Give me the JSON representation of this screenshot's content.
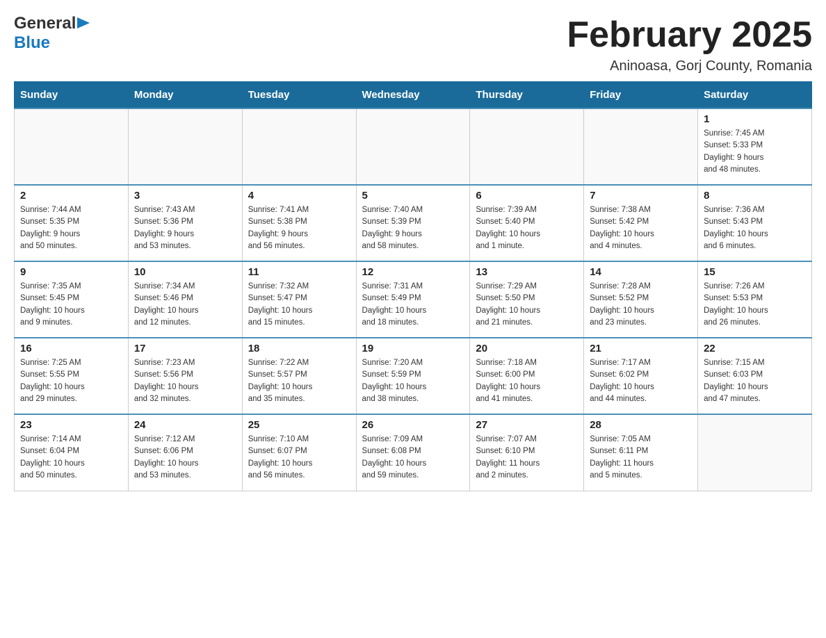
{
  "logo": {
    "general": "General",
    "blue": "Blue"
  },
  "title": "February 2025",
  "subtitle": "Aninoasa, Gorj County, Romania",
  "weekdays": [
    "Sunday",
    "Monday",
    "Tuesday",
    "Wednesday",
    "Thursday",
    "Friday",
    "Saturday"
  ],
  "weeks": [
    [
      {
        "day": "",
        "info": ""
      },
      {
        "day": "",
        "info": ""
      },
      {
        "day": "",
        "info": ""
      },
      {
        "day": "",
        "info": ""
      },
      {
        "day": "",
        "info": ""
      },
      {
        "day": "",
        "info": ""
      },
      {
        "day": "1",
        "info": "Sunrise: 7:45 AM\nSunset: 5:33 PM\nDaylight: 9 hours\nand 48 minutes."
      }
    ],
    [
      {
        "day": "2",
        "info": "Sunrise: 7:44 AM\nSunset: 5:35 PM\nDaylight: 9 hours\nand 50 minutes."
      },
      {
        "day": "3",
        "info": "Sunrise: 7:43 AM\nSunset: 5:36 PM\nDaylight: 9 hours\nand 53 minutes."
      },
      {
        "day": "4",
        "info": "Sunrise: 7:41 AM\nSunset: 5:38 PM\nDaylight: 9 hours\nand 56 minutes."
      },
      {
        "day": "5",
        "info": "Sunrise: 7:40 AM\nSunset: 5:39 PM\nDaylight: 9 hours\nand 58 minutes."
      },
      {
        "day": "6",
        "info": "Sunrise: 7:39 AM\nSunset: 5:40 PM\nDaylight: 10 hours\nand 1 minute."
      },
      {
        "day": "7",
        "info": "Sunrise: 7:38 AM\nSunset: 5:42 PM\nDaylight: 10 hours\nand 4 minutes."
      },
      {
        "day": "8",
        "info": "Sunrise: 7:36 AM\nSunset: 5:43 PM\nDaylight: 10 hours\nand 6 minutes."
      }
    ],
    [
      {
        "day": "9",
        "info": "Sunrise: 7:35 AM\nSunset: 5:45 PM\nDaylight: 10 hours\nand 9 minutes."
      },
      {
        "day": "10",
        "info": "Sunrise: 7:34 AM\nSunset: 5:46 PM\nDaylight: 10 hours\nand 12 minutes."
      },
      {
        "day": "11",
        "info": "Sunrise: 7:32 AM\nSunset: 5:47 PM\nDaylight: 10 hours\nand 15 minutes."
      },
      {
        "day": "12",
        "info": "Sunrise: 7:31 AM\nSunset: 5:49 PM\nDaylight: 10 hours\nand 18 minutes."
      },
      {
        "day": "13",
        "info": "Sunrise: 7:29 AM\nSunset: 5:50 PM\nDaylight: 10 hours\nand 21 minutes."
      },
      {
        "day": "14",
        "info": "Sunrise: 7:28 AM\nSunset: 5:52 PM\nDaylight: 10 hours\nand 23 minutes."
      },
      {
        "day": "15",
        "info": "Sunrise: 7:26 AM\nSunset: 5:53 PM\nDaylight: 10 hours\nand 26 minutes."
      }
    ],
    [
      {
        "day": "16",
        "info": "Sunrise: 7:25 AM\nSunset: 5:55 PM\nDaylight: 10 hours\nand 29 minutes."
      },
      {
        "day": "17",
        "info": "Sunrise: 7:23 AM\nSunset: 5:56 PM\nDaylight: 10 hours\nand 32 minutes."
      },
      {
        "day": "18",
        "info": "Sunrise: 7:22 AM\nSunset: 5:57 PM\nDaylight: 10 hours\nand 35 minutes."
      },
      {
        "day": "19",
        "info": "Sunrise: 7:20 AM\nSunset: 5:59 PM\nDaylight: 10 hours\nand 38 minutes."
      },
      {
        "day": "20",
        "info": "Sunrise: 7:18 AM\nSunset: 6:00 PM\nDaylight: 10 hours\nand 41 minutes."
      },
      {
        "day": "21",
        "info": "Sunrise: 7:17 AM\nSunset: 6:02 PM\nDaylight: 10 hours\nand 44 minutes."
      },
      {
        "day": "22",
        "info": "Sunrise: 7:15 AM\nSunset: 6:03 PM\nDaylight: 10 hours\nand 47 minutes."
      }
    ],
    [
      {
        "day": "23",
        "info": "Sunrise: 7:14 AM\nSunset: 6:04 PM\nDaylight: 10 hours\nand 50 minutes."
      },
      {
        "day": "24",
        "info": "Sunrise: 7:12 AM\nSunset: 6:06 PM\nDaylight: 10 hours\nand 53 minutes."
      },
      {
        "day": "25",
        "info": "Sunrise: 7:10 AM\nSunset: 6:07 PM\nDaylight: 10 hours\nand 56 minutes."
      },
      {
        "day": "26",
        "info": "Sunrise: 7:09 AM\nSunset: 6:08 PM\nDaylight: 10 hours\nand 59 minutes."
      },
      {
        "day": "27",
        "info": "Sunrise: 7:07 AM\nSunset: 6:10 PM\nDaylight: 11 hours\nand 2 minutes."
      },
      {
        "day": "28",
        "info": "Sunrise: 7:05 AM\nSunset: 6:11 PM\nDaylight: 11 hours\nand 5 minutes."
      },
      {
        "day": "",
        "info": ""
      }
    ]
  ]
}
